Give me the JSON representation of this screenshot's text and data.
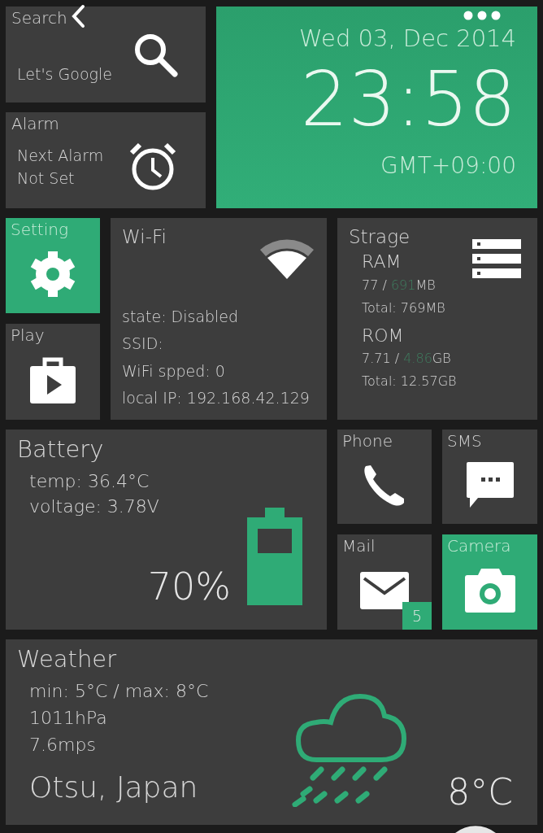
{
  "search": {
    "title": "Search",
    "hint": "Let's Google"
  },
  "alarm": {
    "title": "Alarm",
    "lines": [
      "Next Alarm",
      "Not Set"
    ]
  },
  "clock": {
    "date": "Wed 03, Dec 2014",
    "time": "23:58",
    "timezone": "GMT+09:00"
  },
  "apps": [
    {
      "kind": "setting",
      "label": "Setting",
      "color": "#2fab76"
    },
    {
      "kind": "play",
      "label": "Play",
      "color": "#3d3d3d"
    },
    {
      "kind": "phone",
      "label": "Phone",
      "color": "#3d3d3d"
    },
    {
      "kind": "sms",
      "label": "SMS",
      "color": "#3d3d3d"
    },
    {
      "kind": "mail",
      "label": "Mail",
      "color": "#3d3d3d",
      "badge": "5"
    },
    {
      "kind": "camera",
      "label": "Camera",
      "color": "#2fab76"
    }
  ],
  "wifi": {
    "title": "Wi-Fi",
    "lines": [
      "state: Disabled",
      "SSID:",
      "WiFi spped: 0",
      "local IP: 192.168.42.129"
    ]
  },
  "storage": {
    "title": "Strage",
    "sections": [
      {
        "name": "RAM",
        "used": "77 / ",
        "free": "691",
        "unit": "MB",
        "total": "Total: 769MB"
      },
      {
        "name": "ROM",
        "used": "7.71 / ",
        "free": "4.86",
        "unit": "GB",
        "total": "Total: 12.57GB"
      }
    ]
  },
  "battery": {
    "title": "Battery",
    "lines": [
      "temp: 36.4°C",
      "voltage: 3.78V"
    ],
    "percent": "70%"
  },
  "weather": {
    "title": "Weather",
    "lines": [
      "min: 5°C / max: 8°C",
      "1011hPa",
      "7.6mps"
    ],
    "location": "Otsu, Japan",
    "temperature": "8°C"
  }
}
